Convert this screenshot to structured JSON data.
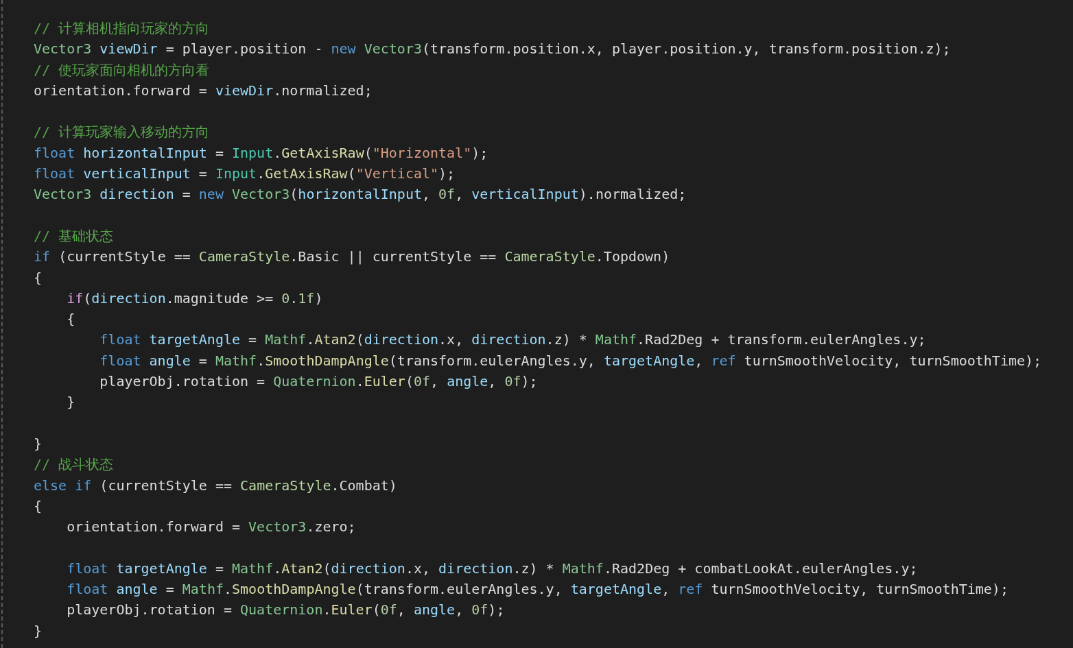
{
  "editor": {
    "lines": [
      {
        "kind": "code",
        "tokens": [
          {
            "kind": "comment",
            "text": "// 计算相机指向玩家的方向"
          }
        ]
      },
      {
        "kind": "code",
        "tokens": [
          {
            "kind": "struct",
            "text": "Vector3 "
          },
          {
            "kind": "local",
            "text": "viewDir"
          },
          {
            "kind": "plain",
            "text": " = player.position - "
          },
          {
            "kind": "keyword",
            "text": "new "
          },
          {
            "kind": "struct",
            "text": "Vector3"
          },
          {
            "kind": "plain",
            "text": "(transform.position.x, player.position.y, transform.position.z);"
          }
        ]
      },
      {
        "kind": "code",
        "tokens": [
          {
            "kind": "comment",
            "text": "// 使玩家面向相机的方向看"
          }
        ]
      },
      {
        "kind": "code",
        "tokens": [
          {
            "kind": "plain",
            "text": "orientation.forward = "
          },
          {
            "kind": "local",
            "text": "viewDir"
          },
          {
            "kind": "plain",
            "text": ".normalized;"
          }
        ]
      },
      {
        "kind": "blank"
      },
      {
        "kind": "code",
        "tokens": [
          {
            "kind": "comment",
            "text": "// 计算玩家输入移动的方向"
          }
        ]
      },
      {
        "kind": "code",
        "tokens": [
          {
            "kind": "keyword",
            "text": "float "
          },
          {
            "kind": "local",
            "text": "horizontalInput"
          },
          {
            "kind": "plain",
            "text": " = "
          },
          {
            "kind": "class",
            "text": "Input"
          },
          {
            "kind": "plain",
            "text": "."
          },
          {
            "kind": "method",
            "text": "GetAxisRaw"
          },
          {
            "kind": "plain",
            "text": "("
          },
          {
            "kind": "string",
            "text": "\"Horizontal\""
          },
          {
            "kind": "plain",
            "text": ");"
          }
        ]
      },
      {
        "kind": "code",
        "tokens": [
          {
            "kind": "keyword",
            "text": "float "
          },
          {
            "kind": "local",
            "text": "verticalInput"
          },
          {
            "kind": "plain",
            "text": " = "
          },
          {
            "kind": "class",
            "text": "Input"
          },
          {
            "kind": "plain",
            "text": "."
          },
          {
            "kind": "method",
            "text": "GetAxisRaw"
          },
          {
            "kind": "plain",
            "text": "("
          },
          {
            "kind": "string",
            "text": "\"Vertical\""
          },
          {
            "kind": "plain",
            "text": ");"
          }
        ]
      },
      {
        "kind": "code",
        "tokens": [
          {
            "kind": "struct",
            "text": "Vector3 "
          },
          {
            "kind": "local",
            "text": "direction"
          },
          {
            "kind": "plain",
            "text": " = "
          },
          {
            "kind": "keyword",
            "text": "new "
          },
          {
            "kind": "struct",
            "text": "Vector3"
          },
          {
            "kind": "plain",
            "text": "("
          },
          {
            "kind": "local",
            "text": "horizontalInput"
          },
          {
            "kind": "plain",
            "text": ", "
          },
          {
            "kind": "number",
            "text": "0f"
          },
          {
            "kind": "plain",
            "text": ", "
          },
          {
            "kind": "local",
            "text": "verticalInput"
          },
          {
            "kind": "plain",
            "text": ").normalized;"
          }
        ]
      },
      {
        "kind": "blank"
      },
      {
        "kind": "code",
        "tokens": [
          {
            "kind": "comment",
            "text": "// 基础状态"
          }
        ]
      },
      {
        "kind": "code",
        "tokens": [
          {
            "kind": "keyword",
            "text": "if"
          },
          {
            "kind": "plain",
            "text": " (currentStyle == "
          },
          {
            "kind": "enum",
            "text": "CameraStyle"
          },
          {
            "kind": "plain",
            "text": ".Basic || currentStyle == "
          },
          {
            "kind": "enum",
            "text": "CameraStyle"
          },
          {
            "kind": "plain",
            "text": ".Topdown)"
          }
        ]
      },
      {
        "kind": "code",
        "tokens": [
          {
            "kind": "plain",
            "text": "{"
          }
        ]
      },
      {
        "kind": "code",
        "tokens": [
          {
            "kind": "control",
            "text": "    if"
          },
          {
            "kind": "plain",
            "text": "("
          },
          {
            "kind": "local",
            "text": "direction"
          },
          {
            "kind": "plain",
            "text": ".magnitude >= "
          },
          {
            "kind": "number",
            "text": "0.1f"
          },
          {
            "kind": "plain",
            "text": ")"
          }
        ]
      },
      {
        "kind": "code",
        "tokens": [
          {
            "kind": "plain",
            "text": "    {"
          }
        ]
      },
      {
        "kind": "code",
        "tokens": [
          {
            "kind": "keyword",
            "text": "        float "
          },
          {
            "kind": "local",
            "text": "targetAngle"
          },
          {
            "kind": "plain",
            "text": " = "
          },
          {
            "kind": "struct",
            "text": "Mathf"
          },
          {
            "kind": "plain",
            "text": "."
          },
          {
            "kind": "method",
            "text": "Atan2"
          },
          {
            "kind": "plain",
            "text": "("
          },
          {
            "kind": "local",
            "text": "direction"
          },
          {
            "kind": "plain",
            "text": ".x, "
          },
          {
            "kind": "local",
            "text": "direction"
          },
          {
            "kind": "plain",
            "text": ".z) * "
          },
          {
            "kind": "struct",
            "text": "Mathf"
          },
          {
            "kind": "plain",
            "text": ".Rad2Deg + transform.eulerAngles.y;"
          }
        ]
      },
      {
        "kind": "code",
        "tokens": [
          {
            "kind": "keyword",
            "text": "        float "
          },
          {
            "kind": "local",
            "text": "angle"
          },
          {
            "kind": "plain",
            "text": " = "
          },
          {
            "kind": "struct",
            "text": "Mathf"
          },
          {
            "kind": "plain",
            "text": "."
          },
          {
            "kind": "method",
            "text": "SmoothDampAngle"
          },
          {
            "kind": "plain",
            "text": "(transform.eulerAngles.y, "
          },
          {
            "kind": "local",
            "text": "targetAngle"
          },
          {
            "kind": "plain",
            "text": ", "
          },
          {
            "kind": "keyword",
            "text": "ref"
          },
          {
            "kind": "plain",
            "text": " turnSmoothVelocity, turnSmoothTime);"
          }
        ]
      },
      {
        "kind": "code",
        "tokens": [
          {
            "kind": "plain",
            "text": "        playerObj.rotation = "
          },
          {
            "kind": "struct",
            "text": "Quaternion"
          },
          {
            "kind": "plain",
            "text": "."
          },
          {
            "kind": "method",
            "text": "Euler"
          },
          {
            "kind": "plain",
            "text": "("
          },
          {
            "kind": "number",
            "text": "0f"
          },
          {
            "kind": "plain",
            "text": ", "
          },
          {
            "kind": "local",
            "text": "angle"
          },
          {
            "kind": "plain",
            "text": ", "
          },
          {
            "kind": "number",
            "text": "0f"
          },
          {
            "kind": "plain",
            "text": ");"
          }
        ]
      },
      {
        "kind": "code",
        "tokens": [
          {
            "kind": "plain",
            "text": "    }"
          }
        ]
      },
      {
        "kind": "blank"
      },
      {
        "kind": "code",
        "tokens": [
          {
            "kind": "plain",
            "text": "}"
          }
        ]
      },
      {
        "kind": "code",
        "tokens": [
          {
            "kind": "comment",
            "text": "// 战斗状态"
          }
        ]
      },
      {
        "kind": "code",
        "tokens": [
          {
            "kind": "keyword",
            "text": "else if"
          },
          {
            "kind": "plain",
            "text": " (currentStyle == "
          },
          {
            "kind": "enum",
            "text": "CameraStyle"
          },
          {
            "kind": "plain",
            "text": ".Combat)"
          }
        ]
      },
      {
        "kind": "code",
        "tokens": [
          {
            "kind": "plain",
            "text": "{"
          }
        ]
      },
      {
        "kind": "code",
        "tokens": [
          {
            "kind": "plain",
            "text": "    orientation.forward = "
          },
          {
            "kind": "struct",
            "text": "Vector3"
          },
          {
            "kind": "plain",
            "text": ".zero;"
          }
        ]
      },
      {
        "kind": "blank"
      },
      {
        "kind": "code",
        "tokens": [
          {
            "kind": "keyword",
            "text": "    float "
          },
          {
            "kind": "local",
            "text": "targetAngle"
          },
          {
            "kind": "plain",
            "text": " = "
          },
          {
            "kind": "struct",
            "text": "Mathf"
          },
          {
            "kind": "plain",
            "text": "."
          },
          {
            "kind": "method",
            "text": "Atan2"
          },
          {
            "kind": "plain",
            "text": "("
          },
          {
            "kind": "local",
            "text": "direction"
          },
          {
            "kind": "plain",
            "text": ".x, "
          },
          {
            "kind": "local",
            "text": "direction"
          },
          {
            "kind": "plain",
            "text": ".z) * "
          },
          {
            "kind": "struct",
            "text": "Mathf"
          },
          {
            "kind": "plain",
            "text": ".Rad2Deg + combatLookAt.eulerAngles.y;"
          }
        ]
      },
      {
        "kind": "code",
        "tokens": [
          {
            "kind": "keyword",
            "text": "    float "
          },
          {
            "kind": "local",
            "text": "angle"
          },
          {
            "kind": "plain",
            "text": " = "
          },
          {
            "kind": "struct",
            "text": "Mathf"
          },
          {
            "kind": "plain",
            "text": "."
          },
          {
            "kind": "method",
            "text": "SmoothDampAngle"
          },
          {
            "kind": "plain",
            "text": "(transform.eulerAngles.y, "
          },
          {
            "kind": "local",
            "text": "targetAngle"
          },
          {
            "kind": "plain",
            "text": ", "
          },
          {
            "kind": "keyword",
            "text": "ref"
          },
          {
            "kind": "plain",
            "text": " turnSmoothVelocity, turnSmoothTime);"
          }
        ]
      },
      {
        "kind": "code",
        "tokens": [
          {
            "kind": "plain",
            "text": "    playerObj.rotation = "
          },
          {
            "kind": "struct",
            "text": "Quaternion"
          },
          {
            "kind": "plain",
            "text": "."
          },
          {
            "kind": "method",
            "text": "Euler"
          },
          {
            "kind": "plain",
            "text": "("
          },
          {
            "kind": "number",
            "text": "0f"
          },
          {
            "kind": "plain",
            "text": ", "
          },
          {
            "kind": "local",
            "text": "angle"
          },
          {
            "kind": "plain",
            "text": ", "
          },
          {
            "kind": "number",
            "text": "0f"
          },
          {
            "kind": "plain",
            "text": ");"
          }
        ]
      },
      {
        "kind": "code",
        "tokens": [
          {
            "kind": "plain",
            "text": "}"
          }
        ]
      }
    ]
  }
}
